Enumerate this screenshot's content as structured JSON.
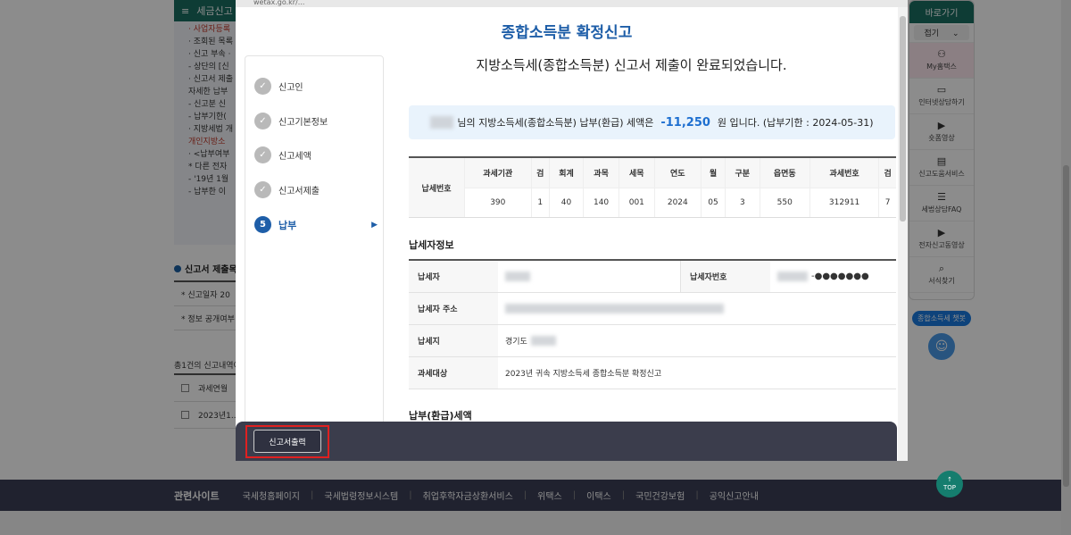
{
  "background": {
    "header_label": "세금신고",
    "notes": [
      {
        "text": "· 사업자등록",
        "red": true
      },
      {
        "text": "· 조회된 목록",
        "red": false
      },
      {
        "text": "· 신고 부속 ·",
        "red": false
      },
      {
        "text": "  - 상단의 [신",
        "red": false
      },
      {
        "text": "· 신고서 제출",
        "red": false
      },
      {
        "text": "  자세한 납부",
        "red": false
      },
      {
        "text": "  - 신고분 신",
        "red": false
      },
      {
        "text": "  - 납부기한(",
        "red": false
      },
      {
        "text": "· 지방세법 개",
        "red": false
      },
      {
        "text": "  개인지방소",
        "red": true
      },
      {
        "text": "· <납부여부",
        "red": false
      },
      {
        "text": "  * 다른 전자",
        "red": false
      },
      {
        "text": "  - '19년 1월",
        "red": false
      },
      {
        "text": "  - 납부한 이",
        "red": false
      }
    ],
    "section_title": "신고서 제출목",
    "form_rows": [
      "* 신고일자  20",
      "* 정보 공개여부"
    ],
    "count_text": "총1건의 신고내역이",
    "table_header": "과세연월",
    "table_row": "2023년1..."
  },
  "footer": {
    "title": "관련사이트",
    "links": [
      "국세청홈페이지",
      "국세법령정보시스템",
      "취업후학자금상환서비스",
      "위택스",
      "이택스",
      "국민건강보험",
      "공익신고안내"
    ]
  },
  "quick": {
    "title": "바로가기",
    "fold": "접기",
    "items": [
      {
        "icon": "user-icon",
        "glyph": "⚇",
        "label": "My홈택스",
        "active": true
      },
      {
        "icon": "laptop-icon",
        "glyph": "▭",
        "label": "인터넷상담하기",
        "active": false
      },
      {
        "icon": "play-icon",
        "glyph": "▶",
        "label": "숏폼영상",
        "active": false
      },
      {
        "icon": "book-icon",
        "glyph": "▤",
        "label": "신고도움서비스",
        "active": false
      },
      {
        "icon": "chat-icon",
        "glyph": "☰",
        "label": "세법상담FAQ",
        "active": false
      },
      {
        "icon": "video-icon",
        "glyph": "▶",
        "label": "전자신고동영상",
        "active": false
      },
      {
        "icon": "search-icon",
        "glyph": "⌕",
        "label": "서식찾기",
        "active": false
      }
    ],
    "chatbot": "종합소득세 챗봇"
  },
  "top_button": "TOP",
  "modal": {
    "url": "wetax.go.kr/...",
    "title": "종합소득분 확정신고",
    "subtitle": "지방소득세(종합소득분) 신고서 제출이 완료되었습니다.",
    "steps": [
      {
        "num": "✓",
        "label": "신고인",
        "active": false
      },
      {
        "num": "✓",
        "label": "신고기본정보",
        "active": false
      },
      {
        "num": "✓",
        "label": "신고세액",
        "active": false
      },
      {
        "num": "✓",
        "label": "신고서제출",
        "active": false
      },
      {
        "num": "5",
        "label": "납부",
        "active": true
      }
    ],
    "notice": {
      "prefix": "님의 지방소득세(종합소득분) 납부(환급) 세액은",
      "amount": "-11,250",
      "suffix": "원 입니다. (납부기한 : 2024-05-31)"
    },
    "taxnum": {
      "label": "납세번호",
      "headers": [
        "과세기관",
        "검",
        "회계",
        "과목",
        "세목",
        "연도",
        "월",
        "구분",
        "읍면동",
        "과세번호",
        "검"
      ],
      "values": [
        "390",
        "1",
        "40",
        "140",
        "001",
        "2024",
        "05",
        "3",
        "550",
        "312911",
        "7"
      ]
    },
    "payer_title": "납세자정보",
    "payer": {
      "name_label": "납세자",
      "id_label": "납세자번호",
      "id_masked": "-●●●●●●●",
      "address_label": "납세자 주소",
      "location_label": "납세지",
      "location_value": "경기도",
      "target_label": "과세대상",
      "target_value": "2023년 귀속 지방소득세 종합소득분 확정신고"
    },
    "refund_title": "납부(환급)세액",
    "print_button": "신고서출력"
  }
}
